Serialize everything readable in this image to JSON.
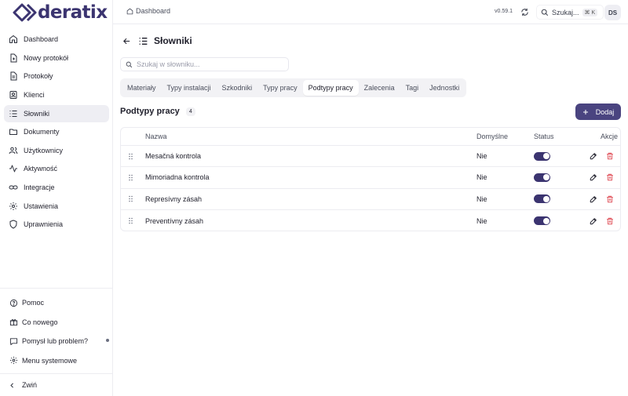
{
  "app": {
    "logo_text": "deratix"
  },
  "sidebar": {
    "items": [
      {
        "label": "Dashboard",
        "icon": "home-icon"
      },
      {
        "label": "Nowy protokół",
        "icon": "file-plus-icon"
      },
      {
        "label": "Protokoły",
        "icon": "file-text-icon"
      },
      {
        "label": "Klienci",
        "icon": "user-icon"
      },
      {
        "label": "Słowniki",
        "icon": "list-icon",
        "active": true
      },
      {
        "label": "Dokumenty",
        "icon": "folder-icon"
      },
      {
        "label": "Użytkownicy",
        "icon": "users-icon"
      },
      {
        "label": "Aktywność",
        "icon": "activity-icon"
      },
      {
        "label": "Integracje",
        "icon": "link-icon"
      },
      {
        "label": "Ustawienia",
        "icon": "gear-icon"
      },
      {
        "label": "Uprawnienia",
        "icon": "shield-icon"
      }
    ],
    "bottom": [
      {
        "label": "Pomoc",
        "icon": "help-circle-icon"
      },
      {
        "label": "Co nowego",
        "icon": "gift-icon"
      },
      {
        "label": "Pomysł lub problem?",
        "icon": "message-icon"
      },
      {
        "label": "Menu systemowe",
        "icon": "gear-icon"
      }
    ],
    "collapse_label": "Zwiń"
  },
  "topbar": {
    "breadcrumb": "Dashboard",
    "version": "v0.59.1",
    "search_label": "Szukaj...",
    "search_shortcut": "⌘ K",
    "avatar_initials": "DS"
  },
  "page": {
    "title": "Słowniki",
    "search_placeholder": "Szukaj w słowniku...",
    "tabs": [
      {
        "label": "Materiały"
      },
      {
        "label": "Typy instalacji"
      },
      {
        "label": "Szkodniki"
      },
      {
        "label": "Typy pracy"
      },
      {
        "label": "Podtypy pracy",
        "active": true
      },
      {
        "label": "Zalecenia"
      },
      {
        "label": "Tagi"
      },
      {
        "label": "Jednostki"
      }
    ],
    "section_title": "Podtypy pracy",
    "count": "4",
    "add_label": "Dodaj"
  },
  "table": {
    "columns": {
      "name": "Nazwa",
      "default": "Domyślne",
      "status": "Status",
      "actions": "Akcje"
    },
    "rows": [
      {
        "name": "Mesačná kontrola",
        "default": "Nie",
        "status": true
      },
      {
        "name": "Mimoriadna kontrola",
        "default": "Nie",
        "status": true
      },
      {
        "name": "Represívny zásah",
        "default": "Nie",
        "status": true
      },
      {
        "name": "Preventívny zásah",
        "default": "Nie",
        "status": true
      }
    ]
  },
  "colors": {
    "accent": "#4a4480",
    "toggle_on": "#3b3470",
    "delete": "#e0525b"
  }
}
